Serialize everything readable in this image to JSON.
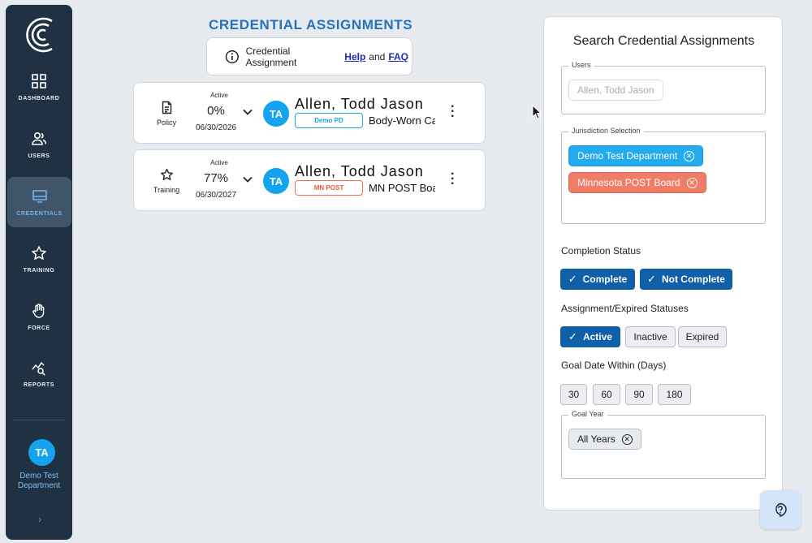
{
  "sidebar": {
    "items": [
      {
        "label": "DASHBOARD",
        "icon": "dashboard-icon"
      },
      {
        "label": "USERS",
        "icon": "users-icon"
      },
      {
        "label": "CREDENTIALS",
        "icon": "credentials-icon"
      },
      {
        "label": "TRAINING",
        "icon": "star-icon"
      },
      {
        "label": "FORCE",
        "icon": "hand-icon"
      },
      {
        "label": "REPORTS",
        "icon": "reports-icon"
      }
    ],
    "active": "CREDENTIALS",
    "user_initials": "TA",
    "user_department": "Demo Test Department"
  },
  "main": {
    "title": "CREDENTIAL ASSIGNMENTS",
    "info": {
      "prefix": "Credential Assignment",
      "help": "Help",
      "and": "and",
      "faq": "FAQ"
    },
    "assignments": [
      {
        "type": "Policy",
        "status": "Active",
        "percent": "0%",
        "date": "06/30/2026",
        "initials": "TA",
        "name": "Allen, Todd Jason",
        "dept_tag": "Demo PD",
        "credential": "Body-Worn Ca"
      },
      {
        "type": "Training",
        "status": "Active",
        "percent": "77%",
        "date": "06/30/2027",
        "initials": "TA",
        "name": "Allen, Todd Jason",
        "dept_tag": "MN POST",
        "credential": "MN POST Boa"
      }
    ]
  },
  "search": {
    "title": "Search Credential Assignments",
    "users_legend": "Users",
    "users_chip": "Allen, Todd Jason",
    "jurisdiction_legend": "Jurisdiction Selection",
    "jurisdictions": [
      "Demo Test Department",
      "Minnesota POST Board"
    ],
    "completion_label": "Completion Status",
    "completion_options": [
      "Complete",
      "Not Complete"
    ],
    "assignment_label": "Assignment/Expired Statuses",
    "assignment_options": [
      "Active",
      "Inactive",
      "Expired"
    ],
    "goal_label": "Goal Date Within (Days)",
    "goal_options": [
      "30",
      "60",
      "90",
      "180"
    ],
    "goal_year_legend": "Goal Year",
    "goal_year_chip": "All Years"
  },
  "colors": {
    "sidebar": "#1f3142",
    "accent": "#0f5fa9",
    "title": "#2472be",
    "avatar": "#13a3ef",
    "chip_blue": "#23abf0",
    "chip_red": "#f07d66"
  }
}
